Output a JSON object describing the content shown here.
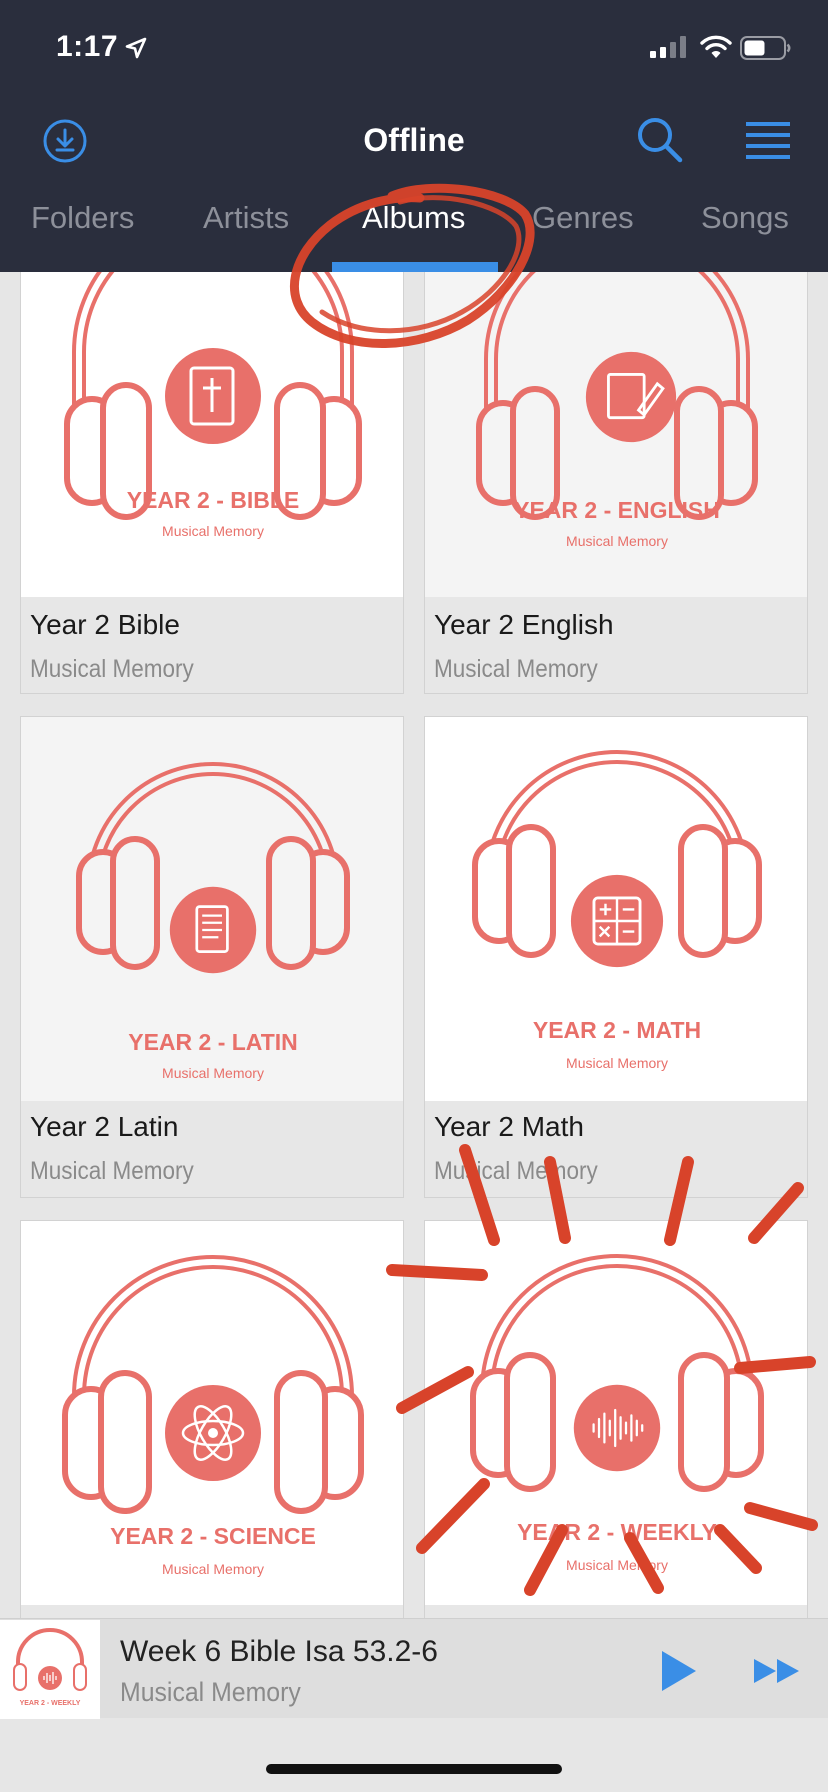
{
  "status": {
    "time": "1:17"
  },
  "header": {
    "title": "Offline"
  },
  "tabs": [
    {
      "label": "Folders",
      "active": false
    },
    {
      "label": "Artists",
      "active": false
    },
    {
      "label": "Albums",
      "active": true
    },
    {
      "label": "Genres",
      "active": false
    },
    {
      "label": "Songs",
      "active": false
    }
  ],
  "albums": [
    {
      "title": "Year 2 Bible",
      "artist": "Musical Memory",
      "art_heading": "YEAR 2 - BIBLE",
      "art_sub": "Musical Memory",
      "art_icon": "bible-icon"
    },
    {
      "title": "Year 2 English",
      "artist": "Musical Memory",
      "art_heading": "YEAR 2 - ENGLISH",
      "art_sub": "Musical Memory",
      "art_icon": "book-pencil-icon"
    },
    {
      "title": "Year 2 Latin",
      "artist": "Musical Memory",
      "art_heading": "YEAR 2 - LATIN",
      "art_sub": "Musical Memory",
      "art_icon": "scroll-icon"
    },
    {
      "title": "Year 2 Math",
      "artist": "Musical Memory",
      "art_heading": "YEAR 2 - MATH",
      "art_sub": "Musical Memory",
      "art_icon": "calculator-icon"
    },
    {
      "title": "",
      "artist": "",
      "art_heading": "YEAR 2 - SCIENCE",
      "art_sub": "Musical Memory",
      "art_icon": "atom-icon"
    },
    {
      "title": "",
      "artist": "",
      "art_heading": "YEAR 2 - WEEKLY",
      "art_sub": "Musical Memory",
      "art_icon": "soundwave-icon"
    }
  ],
  "player": {
    "title": "Week 6 Bible Isa 53.2-6",
    "artist": "Musical Memory",
    "art_heading": "YEAR 2 - WEEKLY"
  },
  "colors": {
    "header_bg": "#2a2e3d",
    "accent_blue": "#3a8ee6",
    "art_red": "#e8706a",
    "marker_red": "#d8432a"
  }
}
